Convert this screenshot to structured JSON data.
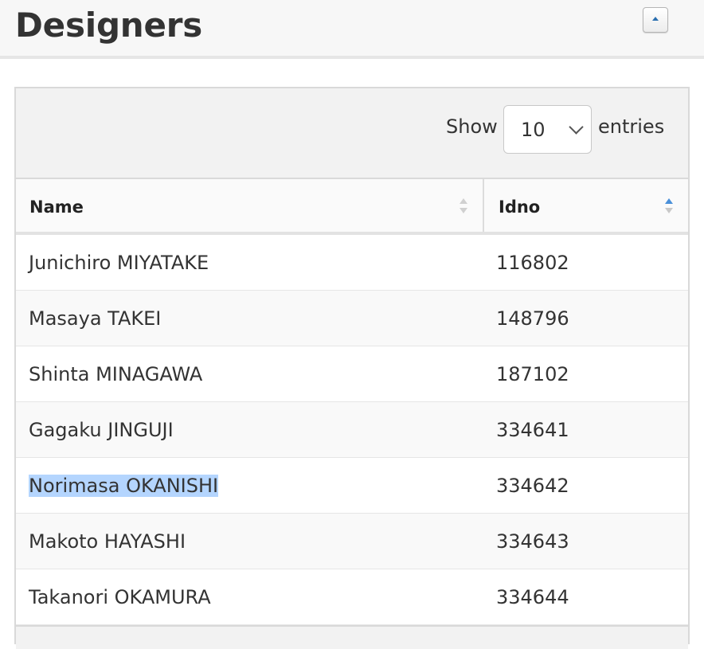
{
  "header": {
    "title": "Designers",
    "collapse_icon": "chevron-up-icon"
  },
  "toolbar": {
    "show_label": "Show",
    "page_length": "10",
    "entries_label": "entries"
  },
  "table": {
    "columns": [
      {
        "label": "Name",
        "sort": "none"
      },
      {
        "label": "Idno",
        "sort": "ascending"
      }
    ],
    "rows": [
      {
        "name": "Junichiro MIYATAKE",
        "idno": "116802"
      },
      {
        "name": "Masaya TAKEI",
        "idno": "148796"
      },
      {
        "name": "Shinta MINAGAWA",
        "idno": "187102"
      },
      {
        "name": "Gagaku JINGUJI",
        "idno": "334641"
      },
      {
        "name": "Norimasa OKANISHI",
        "idno": "334642"
      },
      {
        "name": "Makoto HAYASHI",
        "idno": "334643"
      },
      {
        "name": "Takanori OKAMURA",
        "idno": "334644"
      }
    ]
  },
  "colors": {
    "selection": "#b4d5fe",
    "sort_active": "#4a90d9"
  }
}
